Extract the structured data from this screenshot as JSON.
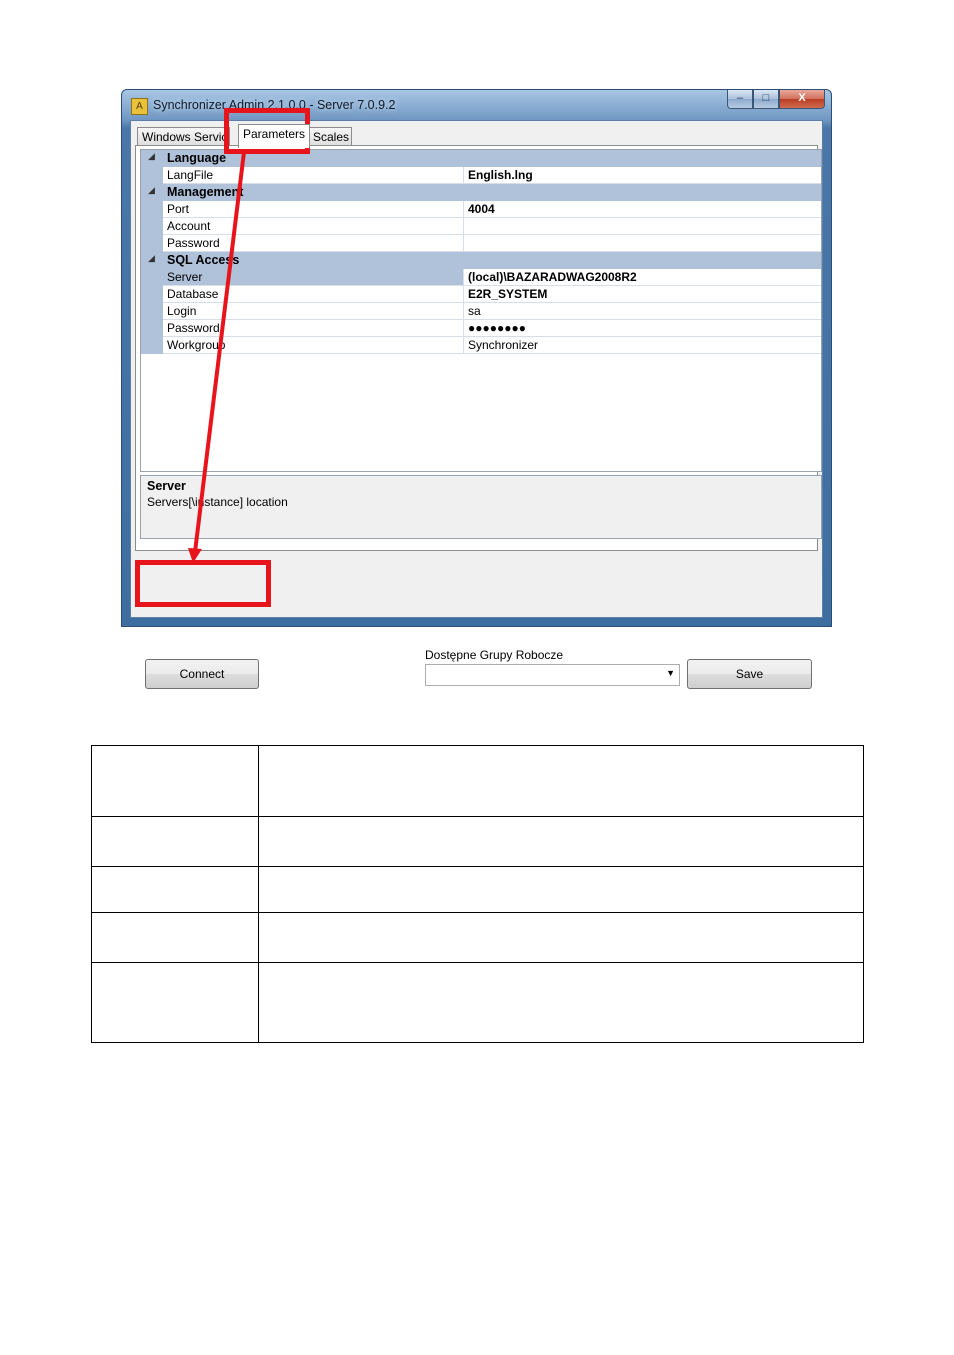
{
  "window": {
    "title": "Synchronizer Admin 2.1.0.0 - Server 7.0.9.2",
    "controls": {
      "minimize": "–",
      "maximize": "□",
      "close": "X"
    }
  },
  "tabs": [
    {
      "label": "Windows Service"
    },
    {
      "label": "Parameters",
      "active": true
    },
    {
      "label": "Scales"
    }
  ],
  "property_grid": {
    "categories": [
      {
        "name": "Language",
        "properties": [
          {
            "name": "LangFile",
            "value": "English.lng",
            "bold": true
          }
        ]
      },
      {
        "name": "Management",
        "properties": [
          {
            "name": "Port",
            "value": "4004",
            "bold": true
          },
          {
            "name": "Account",
            "value": ""
          },
          {
            "name": "Password",
            "value": ""
          }
        ]
      },
      {
        "name": "SQL Access",
        "properties": [
          {
            "name": "Server",
            "value": "(local)\\BAZARADWAG2008R2",
            "bold": true,
            "selected": true
          },
          {
            "name": "Database",
            "value": "E2R_SYSTEM",
            "bold": true
          },
          {
            "name": "Login",
            "value": "sa"
          },
          {
            "name": "Password",
            "value": "●●●●●●●●",
            "bold": true
          },
          {
            "name": "Workgroup",
            "value": "Synchronizer"
          }
        ]
      }
    ]
  },
  "description": {
    "title": "Server",
    "text": "Servers[\\instance] location"
  },
  "bottom": {
    "connect_label": "Connect",
    "workgroups_label": "Dostępne Grupy Robocze",
    "workgroups_value": "",
    "save_label": "Save"
  },
  "annotation": {
    "highlight_color": "#e8141b",
    "icons": [
      "toggle-collapse-icon",
      "dropdown-arrow-icon",
      "app-icon"
    ]
  },
  "table": {
    "rows": [
      [
        "",
        ""
      ],
      [
        "",
        ""
      ],
      [
        "",
        ""
      ],
      [
        "",
        ""
      ],
      [
        "",
        ""
      ]
    ]
  }
}
